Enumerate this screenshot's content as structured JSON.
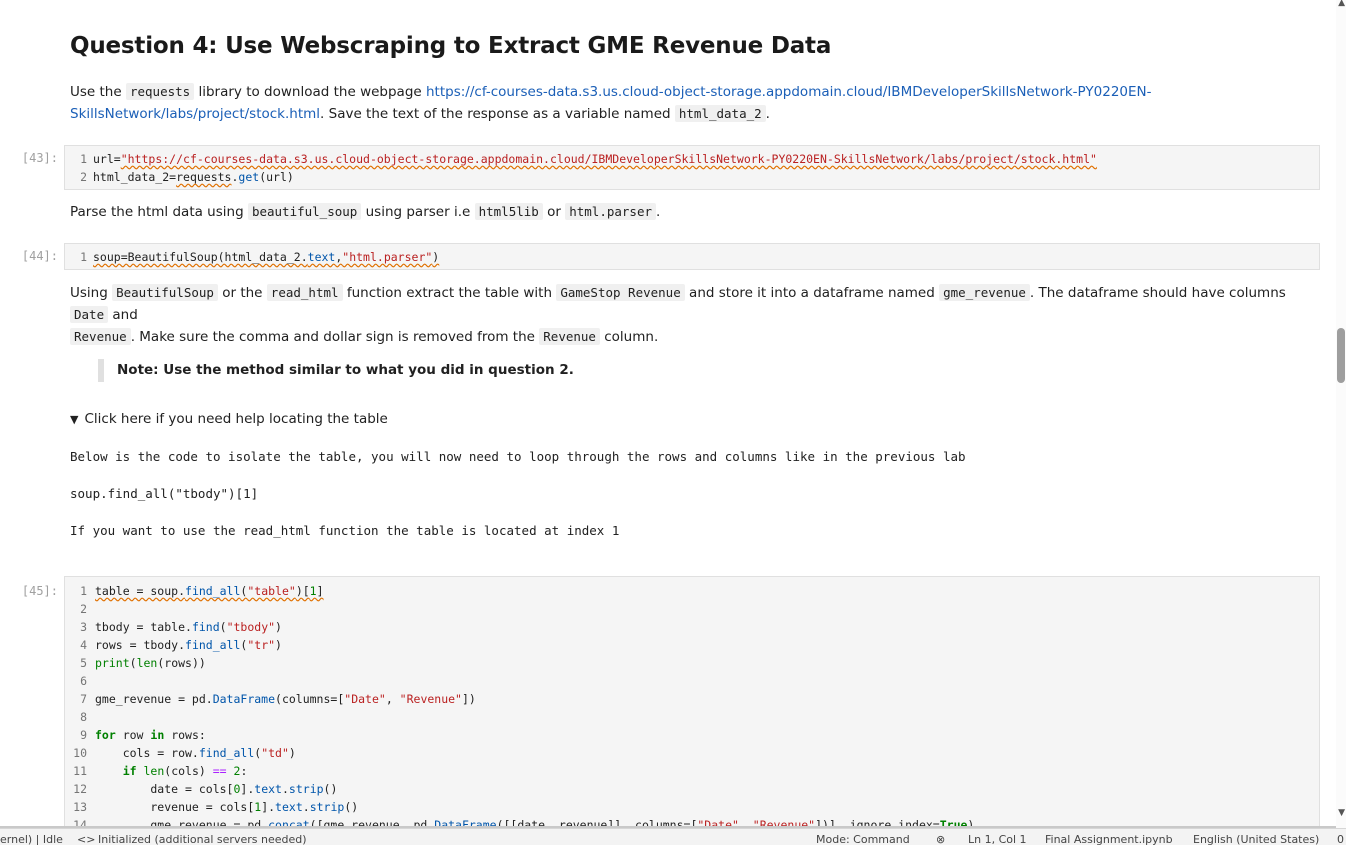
{
  "heading": "Question 4: Use Webscraping to Extract GME Revenue Data",
  "intro": {
    "t1": "Use the",
    "code1": "requests",
    "t2": "library to download the webpage",
    "link1": "https://cf-courses-data.s3.us.cloud-object-storage.appdomain.cloud/IBMDeveloperSkillsNetwork-PY0220EN-",
    "link2": "SkillsNetwork/labs/project/stock.html",
    "t3": ". Save the text of the response as a variable named",
    "code2": "html_data_2",
    "t4": "."
  },
  "cell43": {
    "prompt": "[43]:",
    "lines": [
      {
        "n": "1",
        "a": "url=",
        "s": "\"https://cf-courses-data.s3.us.cloud-object-storage.appdomain.cloud/IBMDeveloperSkillsNetwork-PY0220EN-SkillsNetwork/labs/project/stock.html\""
      },
      {
        "n": "2",
        "a": "html_data_2=",
        "b": "requests",
        "c": ".",
        "d": "get",
        "e": "(url)"
      }
    ]
  },
  "parse": {
    "t1": "Parse the html data using",
    "code1": "beautiful_soup",
    "t2": "using parser i.e",
    "code2": "html5lib",
    "t3": "or",
    "code3": "html.parser",
    "t4": "."
  },
  "cell44": {
    "prompt": "[44]:",
    "n": "1",
    "a": "soup=BeautifulSoup(html_data_2.",
    "b": "text",
    "c": ",",
    "s": "\"html.parser\"",
    "d": ")"
  },
  "using": {
    "t1": "Using",
    "code1": "BeautifulSoup",
    "t2": "or the",
    "code2": "read_html",
    "t3": "function extract the table with",
    "code3": "GameStop Revenue",
    "t4": "and store it into a dataframe named",
    "code4": "gme_revenue",
    "t5": ". The dataframe should have columns",
    "code5": "Date",
    "t6": "and",
    "code6": "Revenue",
    "t7": ". Make sure the comma and dollar sign is removed from the",
    "code7": "Revenue",
    "t8": "column."
  },
  "note": "Note: Use the method similar to what you did in question 2.",
  "details": {
    "summary": "Click here if you need help locating the table",
    "p1": "Below is the code to isolate the table, you will now need to loop through the rows and columns like in the previous lab",
    "p2": "soup.find_all(\"tbody\")[1]",
    "p3": "If you want to use the read_html function the table is located at index 1"
  },
  "cell45": {
    "prompt": "[45]:",
    "line_numbers": [
      "1",
      "2",
      "3",
      "4",
      "5",
      "6",
      "7",
      "8",
      "9",
      "10",
      "11",
      "12",
      "13",
      "14"
    ]
  },
  "statusbar": {
    "kernel": "ernel) | Idle",
    "servers": "Initialized (additional servers needed)",
    "mode": "Mode: Command",
    "position": "Ln 1, Col 1",
    "file": "Final Assignment.ipynb",
    "language": "English (United States)",
    "count": "0"
  },
  "colors": {
    "link": "#1b5fb7",
    "string": "#ba2121",
    "keyword": "#008000",
    "function": "#0055aa"
  }
}
